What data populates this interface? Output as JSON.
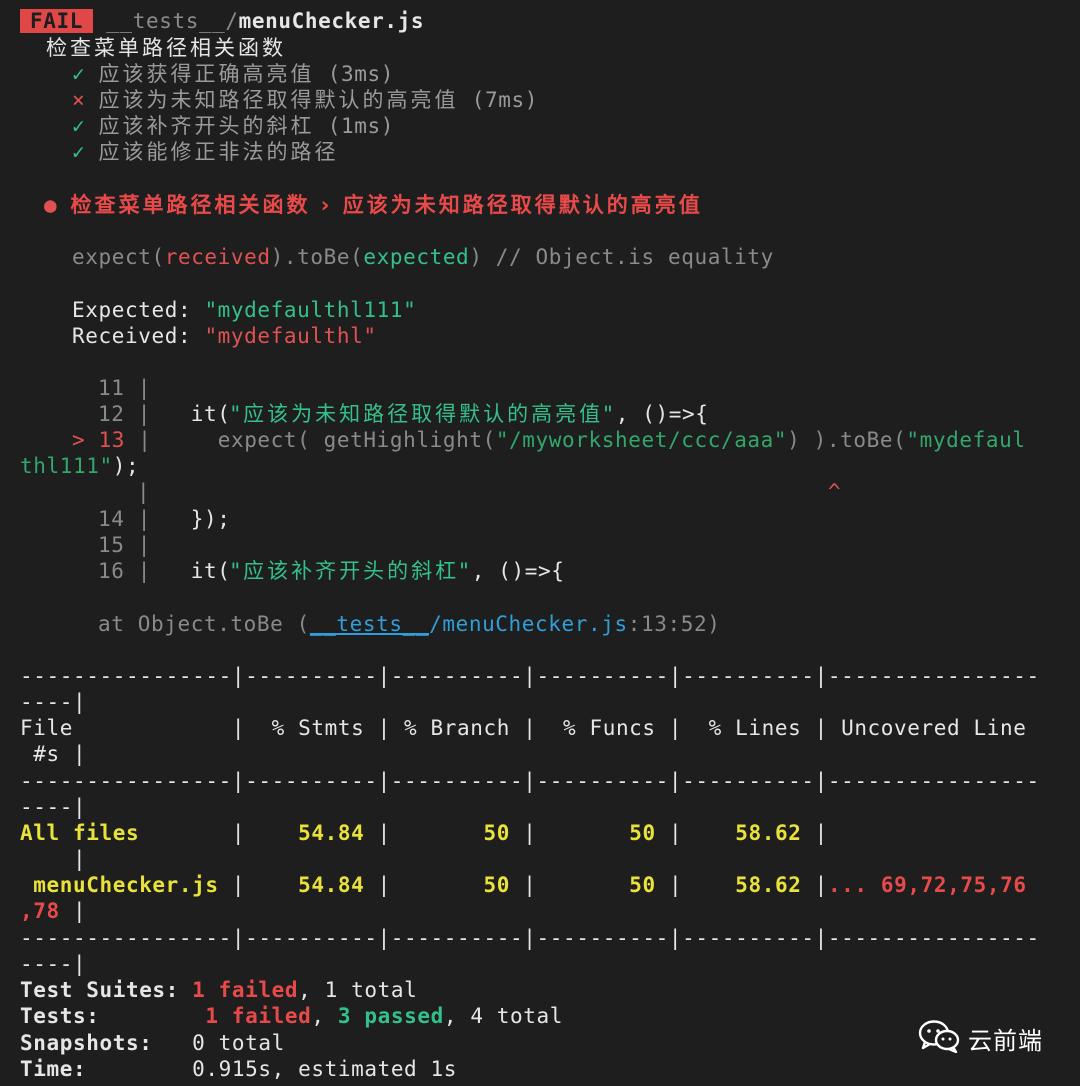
{
  "header": {
    "badge": "FAIL",
    "path_dir": "__tests__/",
    "path_file": "menuChecker.js"
  },
  "suite": {
    "title": "检查菜单路径相关函数",
    "tests": [
      {
        "mark": "✓",
        "name": "应该获得正确高亮值",
        "time": "(3ms)"
      },
      {
        "mark": "×",
        "name": "应该为未知路径取得默认的高亮值",
        "time": "(7ms)"
      },
      {
        "mark": "✓",
        "name": "应该补齐开头的斜杠",
        "time": "(1ms)"
      },
      {
        "mark": "✓",
        "name": "应该能修正非法的路径",
        "time": ""
      }
    ]
  },
  "failure": {
    "bullet": "●",
    "title": "检查菜单路径相关函数 › 应该为未知路径取得默认的高亮值",
    "expect_prefix": "expect(",
    "expect_received": "received",
    "expect_mid": ").toBe(",
    "expect_expected": "expected",
    "expect_suffix": ") // Object.is equality",
    "expected_label": "Expected: ",
    "expected_value": "\"mydefaulthl111\"",
    "received_label": "Received: ",
    "received_value": "\"mydefaulthl\""
  },
  "code": {
    "l11": "11 |",
    "l12_no": "12 |",
    "l12_it": "it(",
    "l12_str": "\"应该为未知路径取得默认的高亮值\"",
    "l12_rest": ", ()=>{",
    "l13_marker": "> 13",
    "l13_bar": " |",
    "l13_a": "expect( getHighlight(",
    "l13_str": "\"/myworksheet/ccc/aaa\"",
    "l13_b": ") ).toBe(",
    "l13_str2a": "\"mydefaul",
    "l13_str2b": "thl111\"",
    "l13_end": ");",
    "caret_bar": "|",
    "caret": "^",
    "l14_no": "14 |",
    "l14_code": "});",
    "l15": "15 |",
    "l16_no": "16 |",
    "l16_it": "it(",
    "l16_str": "\"应该补齐开头的斜杠\"",
    "l16_rest": ", ()=>{"
  },
  "stack": {
    "prefix": "at Object.toBe (",
    "dir": "__tests__",
    "file": "/menuChecker.js",
    "loc": ":13:52)"
  },
  "coverage": {
    "sep1": "----------------|----------|----------|----------|----------|----------------",
    "sep2": "----|",
    "header1": "File            |  % Stmts | % Branch |  % Funcs |  % Lines | Uncovered Line",
    "header2": " #s |",
    "rows": [
      {
        "file": "All files",
        "stmts": "54.84",
        "branch": "50",
        "funcs": "50",
        "lines": "58.62",
        "uncovered": ""
      },
      {
        "file": " menuChecker.js",
        "stmts": "54.84",
        "branch": "50",
        "funcs": "50",
        "lines": "58.62",
        "uncovered": "... 69,72,75,76",
        "uncovered_wrap": ",78"
      }
    ],
    "row_cont": "    |"
  },
  "summary": {
    "suites_label": "Test Suites:",
    "suites_failed": "1 failed",
    "suites_total": ", 1 total",
    "tests_label": "Tests:",
    "tests_failed": "1 failed",
    "tests_sep": ", ",
    "tests_passed": "3 passed",
    "tests_total": ", 4 total",
    "snap_label": "Snapshots:",
    "snap_value": "0 total",
    "time_label": "Time:",
    "time_value": "0.915s, estimated 1s"
  },
  "watermark": {
    "icon": "wechat-icon",
    "text": "云前端"
  },
  "colors": {
    "background": "#1e1e1e",
    "fail": "#e04848",
    "pass": "#34c08a",
    "highlight": "#e8e23a",
    "link": "#2f9ed9"
  }
}
